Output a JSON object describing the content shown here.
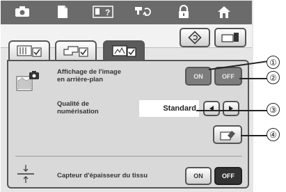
{
  "top_nav": [
    {
      "id": "camera",
      "icon": "camera-icon"
    },
    {
      "id": "page",
      "icon": "page-icon"
    },
    {
      "id": "help",
      "icon": "help-icon",
      "label": "?"
    },
    {
      "id": "sewing",
      "icon": "needle-thread-icon"
    },
    {
      "id": "lock",
      "icon": "lock-icon"
    },
    {
      "id": "home",
      "icon": "home-icon"
    }
  ],
  "tabs": [
    {
      "id": "general",
      "icon": "general-settings-icon",
      "active": false
    },
    {
      "id": "sewing",
      "icon": "sewing-settings-icon",
      "active": false
    },
    {
      "id": "embroidery",
      "icon": "embroidery-settings-icon",
      "active": true
    }
  ],
  "right_buttons": [
    {
      "icon": "reset-icon"
    },
    {
      "icon": "machine-info-icon"
    }
  ],
  "settings": {
    "background_image": {
      "label_line1": "Affichage de l'image",
      "label_line2": "en arrière-plan",
      "on": "ON",
      "off": "OFF"
    },
    "scan_quality": {
      "label_line1": "Qualité de",
      "label_line2": "numérisation",
      "value": "Standard"
    },
    "thickness_sensor": {
      "label": "Capteur d'épaisseur du tissu",
      "on": "ON",
      "off": "OFF"
    }
  },
  "callouts": [
    "①",
    "②",
    "③",
    "④"
  ]
}
